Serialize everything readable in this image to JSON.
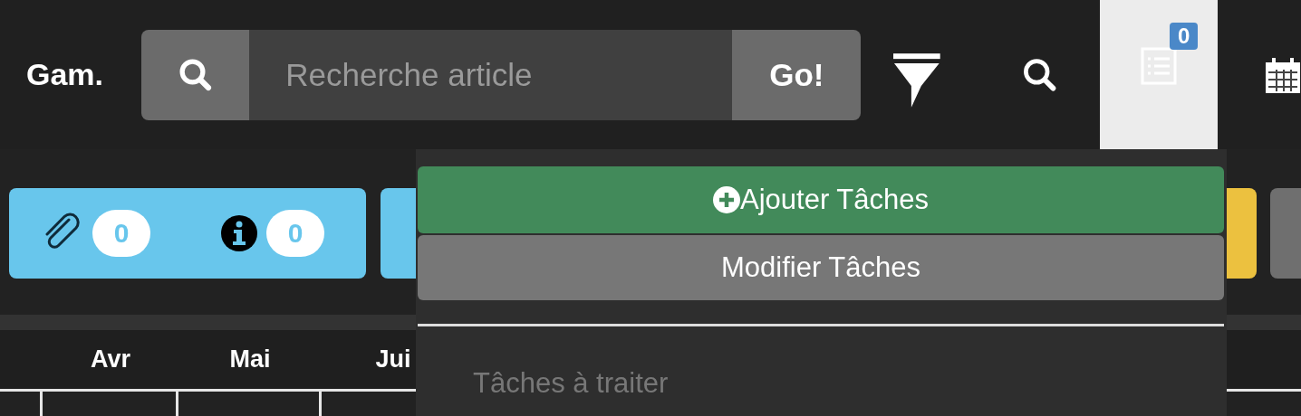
{
  "header": {
    "title": "Gam.",
    "search": {
      "placeholder": "Recherche article",
      "button": "Go!"
    },
    "tasks_tab": {
      "selected": true,
      "badge": "0"
    }
  },
  "summary_card": {
    "attachments": "0",
    "infos": "0"
  },
  "months": [
    "Avr",
    "Mai",
    "Jui"
  ],
  "tasks_menu": {
    "items": [
      {
        "kind": "add",
        "label": "Ajouter Tâches"
      },
      {
        "kind": "edit",
        "label": "Modifier Tâches"
      }
    ],
    "section": "Tâches à traiter"
  }
}
